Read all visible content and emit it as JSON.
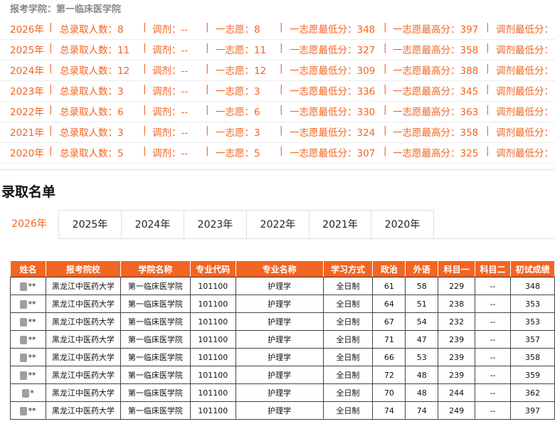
{
  "school_title": "报考学院：第一临床医学院",
  "stats_rows": [
    {
      "year": "2026年",
      "total": "总录取人数：8",
      "adjust": "调剂：--",
      "first": "一志愿：8",
      "min": "一志愿最低分：348",
      "max": "一志愿最高分：397",
      "adjust_min": "调剂最低分："
    },
    {
      "year": "2025年",
      "total": "总录取人数：11",
      "adjust": "调剂：--",
      "first": "一志愿：11",
      "min": "一志愿最低分：327",
      "max": "一志愿最高分：358",
      "adjust_min": "调剂最低分："
    },
    {
      "year": "2024年",
      "total": "总录取人数：12",
      "adjust": "调剂：--",
      "first": "一志愿：12",
      "min": "一志愿最低分：309",
      "max": "一志愿最高分：388",
      "adjust_min": "调剂最低分："
    },
    {
      "year": "2023年",
      "total": "总录取人数：3",
      "adjust": "调剂：--",
      "first": "一志愿：3",
      "min": "一志愿最低分：336",
      "max": "一志愿最高分：345",
      "adjust_min": "调剂最低分："
    },
    {
      "year": "2022年",
      "total": "总录取人数：6",
      "adjust": "调剂：--",
      "first": "一志愿：6",
      "min": "一志愿最低分：330",
      "max": "一志愿最高分：363",
      "adjust_min": "调剂最低分："
    },
    {
      "year": "2021年",
      "total": "总录取人数：3",
      "adjust": "调剂：--",
      "first": "一志愿：3",
      "min": "一志愿最低分：324",
      "max": "一志愿最高分：358",
      "adjust_min": "调剂最低分："
    },
    {
      "year": "2020年",
      "total": "总录取人数：5",
      "adjust": "调剂：--",
      "first": "一志愿：5",
      "min": "一志愿最低分：307",
      "max": "一志愿最高分：325",
      "adjust_min": "调剂最低分："
    }
  ],
  "separator": "|",
  "section_title": "录取名单",
  "tabs": [
    "2026年",
    "2025年",
    "2024年",
    "2023年",
    "2022年",
    "2021年",
    "2020年"
  ],
  "active_tab": "2026年",
  "table": {
    "headers": [
      "姓名",
      "报考院校",
      "学院名称",
      "专业代码",
      "专业名称",
      "学习方式",
      "政治",
      "外语",
      "科目一",
      "科目二",
      "初试成绩"
    ],
    "rows": [
      [
        "**",
        "黑龙江中医药大学",
        "第一临床医学院",
        "101100",
        "护理学",
        "全日制",
        "61",
        "58",
        "229",
        "--",
        "348"
      ],
      [
        "**",
        "黑龙江中医药大学",
        "第一临床医学院",
        "101100",
        "护理学",
        "全日制",
        "64",
        "51",
        "238",
        "--",
        "353"
      ],
      [
        "**",
        "黑龙江中医药大学",
        "第一临床医学院",
        "101100",
        "护理学",
        "全日制",
        "67",
        "54",
        "232",
        "--",
        "353"
      ],
      [
        "**",
        "黑龙江中医药大学",
        "第一临床医学院",
        "101100",
        "护理学",
        "全日制",
        "71",
        "47",
        "239",
        "--",
        "357"
      ],
      [
        "**",
        "黑龙江中医药大学",
        "第一临床医学院",
        "101100",
        "护理学",
        "全日制",
        "66",
        "53",
        "239",
        "--",
        "358"
      ],
      [
        "**",
        "黑龙江中医药大学",
        "第一临床医学院",
        "101100",
        "护理学",
        "全日制",
        "72",
        "48",
        "239",
        "--",
        "359"
      ],
      [
        "*",
        "黑龙江中医药大学",
        "第一临床医学院",
        "101100",
        "护理学",
        "全日制",
        "70",
        "48",
        "244",
        "--",
        "362"
      ],
      [
        "**",
        "黑龙江中医药大学",
        "第一临床医学院",
        "101100",
        "护理学",
        "全日制",
        "74",
        "74",
        "249",
        "--",
        "397"
      ]
    ]
  },
  "colors": {
    "accent": "#f26522",
    "header_text": "#ffffff",
    "muted": "#888888"
  }
}
